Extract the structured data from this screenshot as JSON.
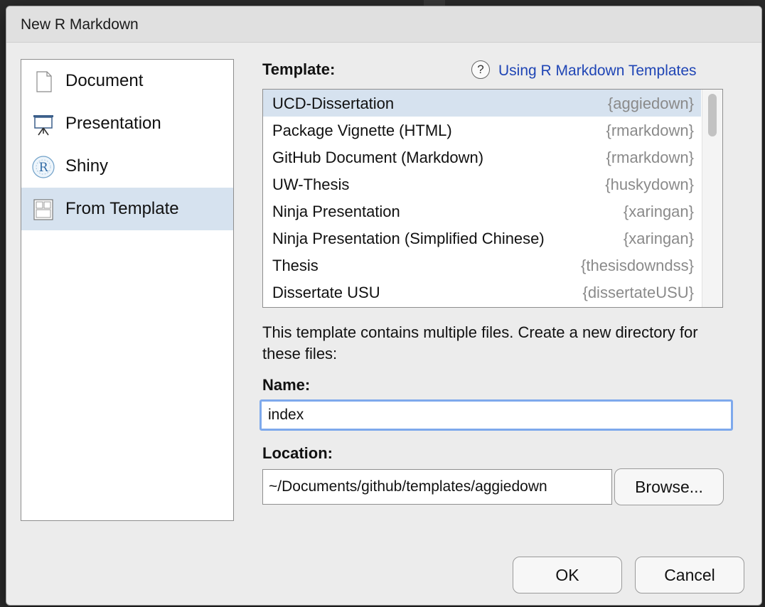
{
  "dialog": {
    "title": "New R Markdown"
  },
  "sidebar": {
    "items": [
      {
        "label": "Document",
        "icon": "document-icon",
        "selected": false
      },
      {
        "label": "Presentation",
        "icon": "presentation-easel-icon",
        "selected": false
      },
      {
        "label": "Shiny",
        "icon": "shiny-r-icon",
        "selected": false
      },
      {
        "label": "From Template",
        "icon": "template-icon",
        "selected": true
      }
    ]
  },
  "template": {
    "label": "Template:",
    "help_link": "Using R Markdown Templates",
    "help_icon": "help-question-icon",
    "items": [
      {
        "name": "UCD-Dissertation",
        "package": "{aggiedown}",
        "selected": true
      },
      {
        "name": "Package Vignette (HTML)",
        "package": "{rmarkdown}"
      },
      {
        "name": "GitHub Document (Markdown)",
        "package": "{rmarkdown}"
      },
      {
        "name": "UW-Thesis",
        "package": "{huskydown}"
      },
      {
        "name": "Ninja Presentation",
        "package": "{xaringan}"
      },
      {
        "name": "Ninja Presentation (Simplified Chinese)",
        "package": "{xaringan}"
      },
      {
        "name": "Thesis",
        "package": "{thesisdowndss}"
      },
      {
        "name": "Dissertate USU",
        "package": "{dissertateUSU}"
      }
    ]
  },
  "description": "This template contains multiple files. Create a new directory for these files:",
  "name_field": {
    "label": "Name:",
    "value": "index"
  },
  "location_field": {
    "label": "Location:",
    "value": "~/Documents/github/templates/aggiedown",
    "browse_label": "Browse..."
  },
  "buttons": {
    "ok": "OK",
    "cancel": "Cancel"
  },
  "colors": {
    "selection": "#d6e2ef",
    "link": "#1f45b5",
    "focus_ring": "#7ea9ec",
    "package_text": "#8a8a8a"
  }
}
